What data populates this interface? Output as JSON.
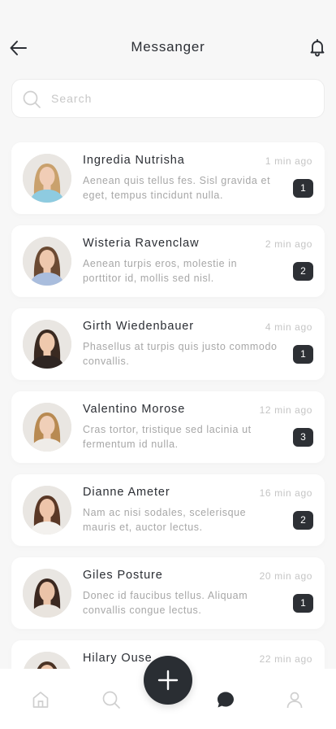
{
  "header": {
    "title": "Messanger",
    "back_icon": "arrow-left-icon",
    "notification_icon": "bell-icon"
  },
  "search": {
    "placeholder": "Search",
    "value": "",
    "icon": "search-icon"
  },
  "conversations": [
    {
      "name": "Ingredia Nutrisha",
      "time": "1 min ago",
      "preview": "Aenean quis tellus fes. Sisl gravida et eget, tempus tincidunt nulla.",
      "unread": "1",
      "avatar": {
        "hair": "#c9a16d",
        "shirt": "#8ecbe0",
        "skin": "#f1cdb6"
      }
    },
    {
      "name": "Wisteria Ravenclaw",
      "time": "2 min ago",
      "preview": "Aenean turpis eros, molestie in porttitor id, mollis sed nisl.",
      "unread": "2",
      "avatar": {
        "hair": "#6b4a33",
        "shirt": "#a9bddd",
        "skin": "#eec8ad"
      }
    },
    {
      "name": "Girth Wiedenbauer",
      "time": "4 min ago",
      "preview": "Phasellus at turpis quis justo commodo convallis.",
      "unread": "1",
      "avatar": {
        "hair": "#3a2a21",
        "shirt": "#2e2522",
        "skin": "#efc9ad"
      }
    },
    {
      "name": "Valentino Morose",
      "time": "12 min ago",
      "preview": "Cras tortor, tristique sed lacinia ut fermentum id nulla.",
      "unread": "3",
      "avatar": {
        "hair": "#b88a52",
        "shirt": "#efece8",
        "skin": "#f0cfb8"
      }
    },
    {
      "name": "Dianne Ameter",
      "time": "16 min ago",
      "preview": "Nam ac nisi sodales, scelerisque mauris et, auctor lectus.",
      "unread": "2",
      "avatar": {
        "hair": "#5a3826",
        "shirt": "#f3f1ee",
        "skin": "#eec5aa"
      }
    },
    {
      "name": "Giles Posture",
      "time": "20 min ago",
      "preview": "Donec id faucibus tellus. Aliquam convallis congue lectus.",
      "unread": "1",
      "avatar": {
        "hair": "#3b2820",
        "shirt": "#e9e4de",
        "skin": "#eac3a8"
      }
    },
    {
      "name": "Hilary Ouse",
      "time": "22 min ago",
      "preview": "",
      "unread": "",
      "avatar": {
        "hair": "#4a3325",
        "shirt": "#e6e1db",
        "skin": "#eec7ac"
      }
    }
  ],
  "bottom_nav": {
    "items": [
      "home-icon",
      "search-icon",
      "chat-icon",
      "profile-icon"
    ],
    "active": "chat-icon",
    "fab_icon": "plus-icon"
  },
  "colors": {
    "accent": "#2d3035",
    "background": "#f7f7f7",
    "card": "#ffffff",
    "muted_text": "#a7a7a7"
  }
}
